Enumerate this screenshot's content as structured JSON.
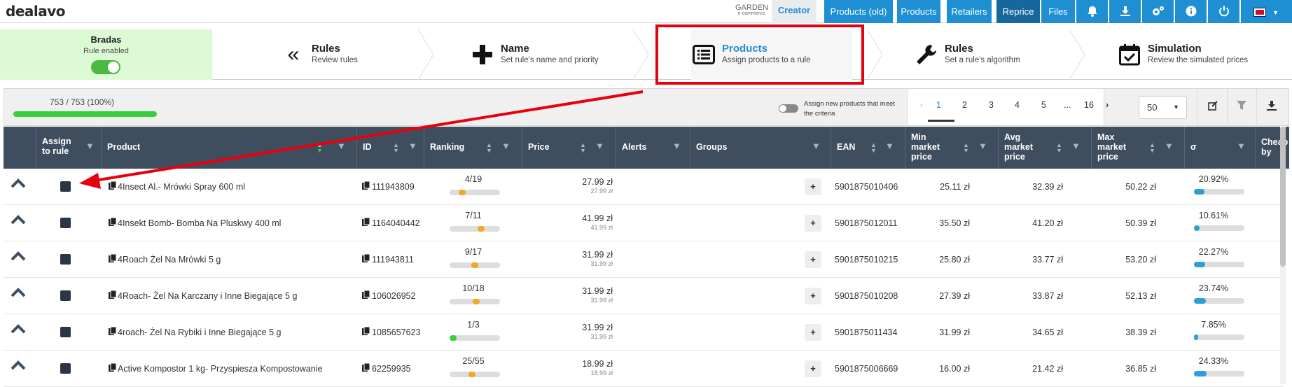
{
  "app": {
    "logo": "dealavo",
    "store_logo_main": "GARDEN",
    "store_logo_sub": "e-commerce"
  },
  "nav": {
    "creator": "Creator",
    "items": [
      {
        "label": "Products (old)"
      },
      {
        "label": "Products"
      },
      {
        "label": "Retailers"
      },
      {
        "label": "Reprice"
      },
      {
        "label": "Files"
      }
    ],
    "icons": [
      "bell-icon",
      "download-icon",
      "gears-icon",
      "info-icon",
      "power-icon",
      "flag-icon"
    ]
  },
  "rule": {
    "name": "Bradas",
    "status": "Rule enabled",
    "enabled": true
  },
  "wizard": [
    {
      "title": "Rules",
      "subtitle": "Review rules",
      "icon": "double-chevron-left-icon"
    },
    {
      "title": "Name",
      "subtitle": "Set rule's name and priority",
      "icon": "plus-icon"
    },
    {
      "title": "Products",
      "subtitle": "Assign products to a rule",
      "icon": "list-icon"
    },
    {
      "title": "Rules",
      "subtitle": "Set a rule's algorithm",
      "icon": "wrench-icon"
    },
    {
      "title": "Simulation",
      "subtitle": "Review the simulated prices",
      "icon": "calendar-check-icon"
    }
  ],
  "toolbar": {
    "progress_text": "753 / 753 (100%)",
    "progress": 1.0,
    "assign_text": "Assign new products that meet the criteria",
    "pages": [
      "1",
      "2",
      "3",
      "4",
      "5",
      "...",
      "16"
    ],
    "page_size": "50"
  },
  "columns": {
    "assign": "Assign to rule",
    "product": "Product",
    "id": "ID",
    "ranking": "Ranking",
    "price": "Price",
    "alerts": "Alerts",
    "groups": "Groups",
    "ean": "EAN",
    "min": "Min market price",
    "avg": "Avg market price",
    "max": "Max market price",
    "sigma": "σ",
    "cheap": "Cheap by"
  },
  "rows": [
    {
      "name": "4Insect Al.- Mrówki Spray 600 ml",
      "id": "111943809",
      "rank": "4/19",
      "rank_pos": 0.21,
      "price": "27.99 zł",
      "price2": "27.99 zł",
      "ean": "5901875010406",
      "min": "25.11 zł",
      "avg": "32.39 zł",
      "max": "50.22 zł",
      "sigma": "20.92%",
      "sigma_v": 0.2092
    },
    {
      "name": "4Insekt Bomb- Bomba Na Pluskwy 400 ml",
      "id": "1164040442",
      "rank": "7/11",
      "rank_pos": 0.64,
      "price": "41.99 zł",
      "price2": "41.99 zł",
      "ean": "5901875012011",
      "min": "35.50 zł",
      "avg": "41.20 zł",
      "max": "50.39 zł",
      "sigma": "10.61%",
      "sigma_v": 0.1061
    },
    {
      "name": "4Roach Żel Na Mrówki 5 g",
      "id": "111943811",
      "rank": "9/17",
      "rank_pos": 0.5,
      "price": "31.99 zł",
      "price2": "31.99 zł",
      "ean": "5901875010215",
      "min": "25.80 zł",
      "avg": "33.77 zł",
      "max": "53.20 zł",
      "sigma": "22.27%",
      "sigma_v": 0.2227
    },
    {
      "name": "4Roach- Żel Na Karczany i Inne Biegające 5 g",
      "id": "106026952",
      "rank": "10/18",
      "rank_pos": 0.53,
      "price": "31.99 zł",
      "price2": "31.99 zł",
      "ean": "5901875010208",
      "min": "27.39 zł",
      "avg": "33.87 zł",
      "max": "52.13 zł",
      "sigma": "23.74%",
      "sigma_v": 0.2374
    },
    {
      "name": "4roach- Żel Na Rybiki i Inne Biegające 5 g",
      "id": "1085657623",
      "rank": "1/3",
      "rank_pos": 0.0,
      "price": "31.99 zł",
      "price2": "31.99 zł",
      "ean": "5901875011434",
      "min": "31.99 zł",
      "avg": "34.65 zł",
      "max": "38.39 zł",
      "sigma": "7.85%",
      "sigma_v": 0.0785
    },
    {
      "name": "Active Kompostor 1 kg- Przyspiesza Kompostowanie",
      "id": "62259935",
      "rank": "25/55",
      "rank_pos": 0.44,
      "price": "18.99 zł",
      "price2": "18.99 zł",
      "ean": "5901875006669",
      "min": "16.00 zł",
      "avg": "21.42 zł",
      "max": "36.85 zł",
      "sigma": "24.33%",
      "sigma_v": 0.2433
    }
  ],
  "colors": {
    "nav_blue": "#1e8fd3",
    "nav_active": "#16689c",
    "header": "#3f4e5f",
    "enabled_bg": "#dcfbd4",
    "highlight": "#e8000f"
  }
}
